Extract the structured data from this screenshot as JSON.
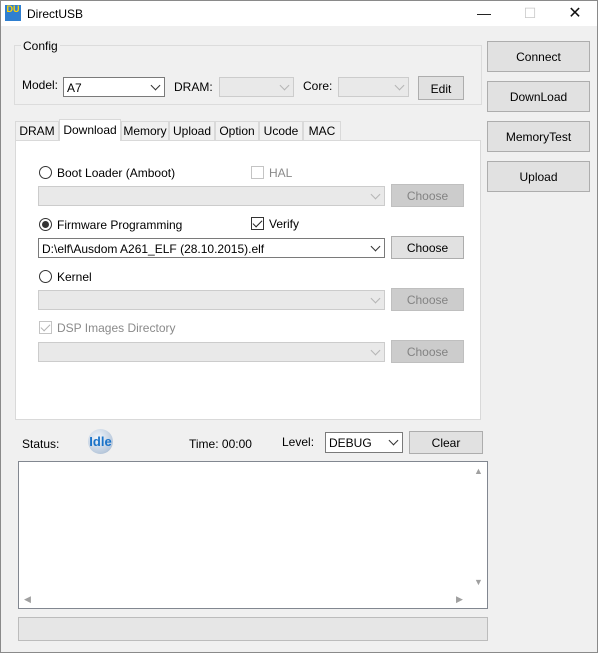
{
  "window": {
    "title": "DirectUSB",
    "icon_text": "DU",
    "controls": {
      "minimize": "—",
      "maximize": "☐",
      "close": "✕"
    }
  },
  "config": {
    "group_title": "Config",
    "model_label": "Model:",
    "model_value": "A7",
    "dram_label": "DRAM:",
    "dram_value": "",
    "core_label": "Core:",
    "core_value": "",
    "edit_label": "Edit"
  },
  "side_buttons": {
    "connect": "Connect",
    "download": "DownLoad",
    "memory_test": "MemoryTest",
    "upload": "Upload"
  },
  "tabs": [
    "DRAM",
    "Download",
    "Memory",
    "Upload",
    "Option",
    "Ucode",
    "MAC"
  ],
  "active_tab": "Download",
  "download": {
    "boot_loader": {
      "label": "Boot Loader (Amboot)",
      "checked": false,
      "path": "",
      "choose": "Choose"
    },
    "hal": {
      "label": "HAL",
      "checked": false,
      "enabled": false
    },
    "firmware": {
      "label": "Firmware Programming",
      "checked": true,
      "path": "D:\\elf\\Ausdom A261_ELF (28.10.2015).elf",
      "choose": "Choose"
    },
    "verify": {
      "label": "Verify",
      "checked": true
    },
    "kernel": {
      "label": "Kernel",
      "checked": false,
      "path": "",
      "choose": "Choose"
    },
    "dsp": {
      "label": "DSP Images Directory",
      "checked": true,
      "enabled": false,
      "path": "",
      "choose": "Choose"
    }
  },
  "status": {
    "status_label": "Status:",
    "state": "Idle",
    "time_label": "Time: 00:00",
    "level_label": "Level:",
    "level_value": "DEBUG",
    "clear_label": "Clear"
  },
  "log": {
    "text": "",
    "progress": 0
  }
}
